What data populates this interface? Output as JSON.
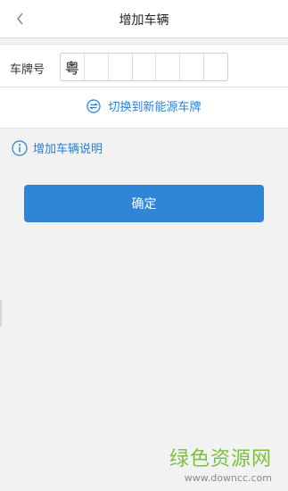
{
  "header": {
    "title": "增加车辆",
    "back_icon": "chevron-left-icon"
  },
  "plate": {
    "label": "车牌号",
    "cells": [
      "粤",
      "",
      "",
      "",
      "",
      "",
      ""
    ],
    "switch_link": "切换到新能源车牌",
    "switch_icon": "swap-icon"
  },
  "info": {
    "label": "增加车辆说明",
    "icon": "info-circle-icon"
  },
  "actions": {
    "confirm_label": "确定"
  },
  "watermark": {
    "brand": "绿色资源网",
    "url": "www.downcc.com"
  },
  "colors": {
    "accent": "#2f86d6",
    "link": "#2a7fd4",
    "background": "#f2f2f2",
    "watermark": "#7fbf3f"
  }
}
